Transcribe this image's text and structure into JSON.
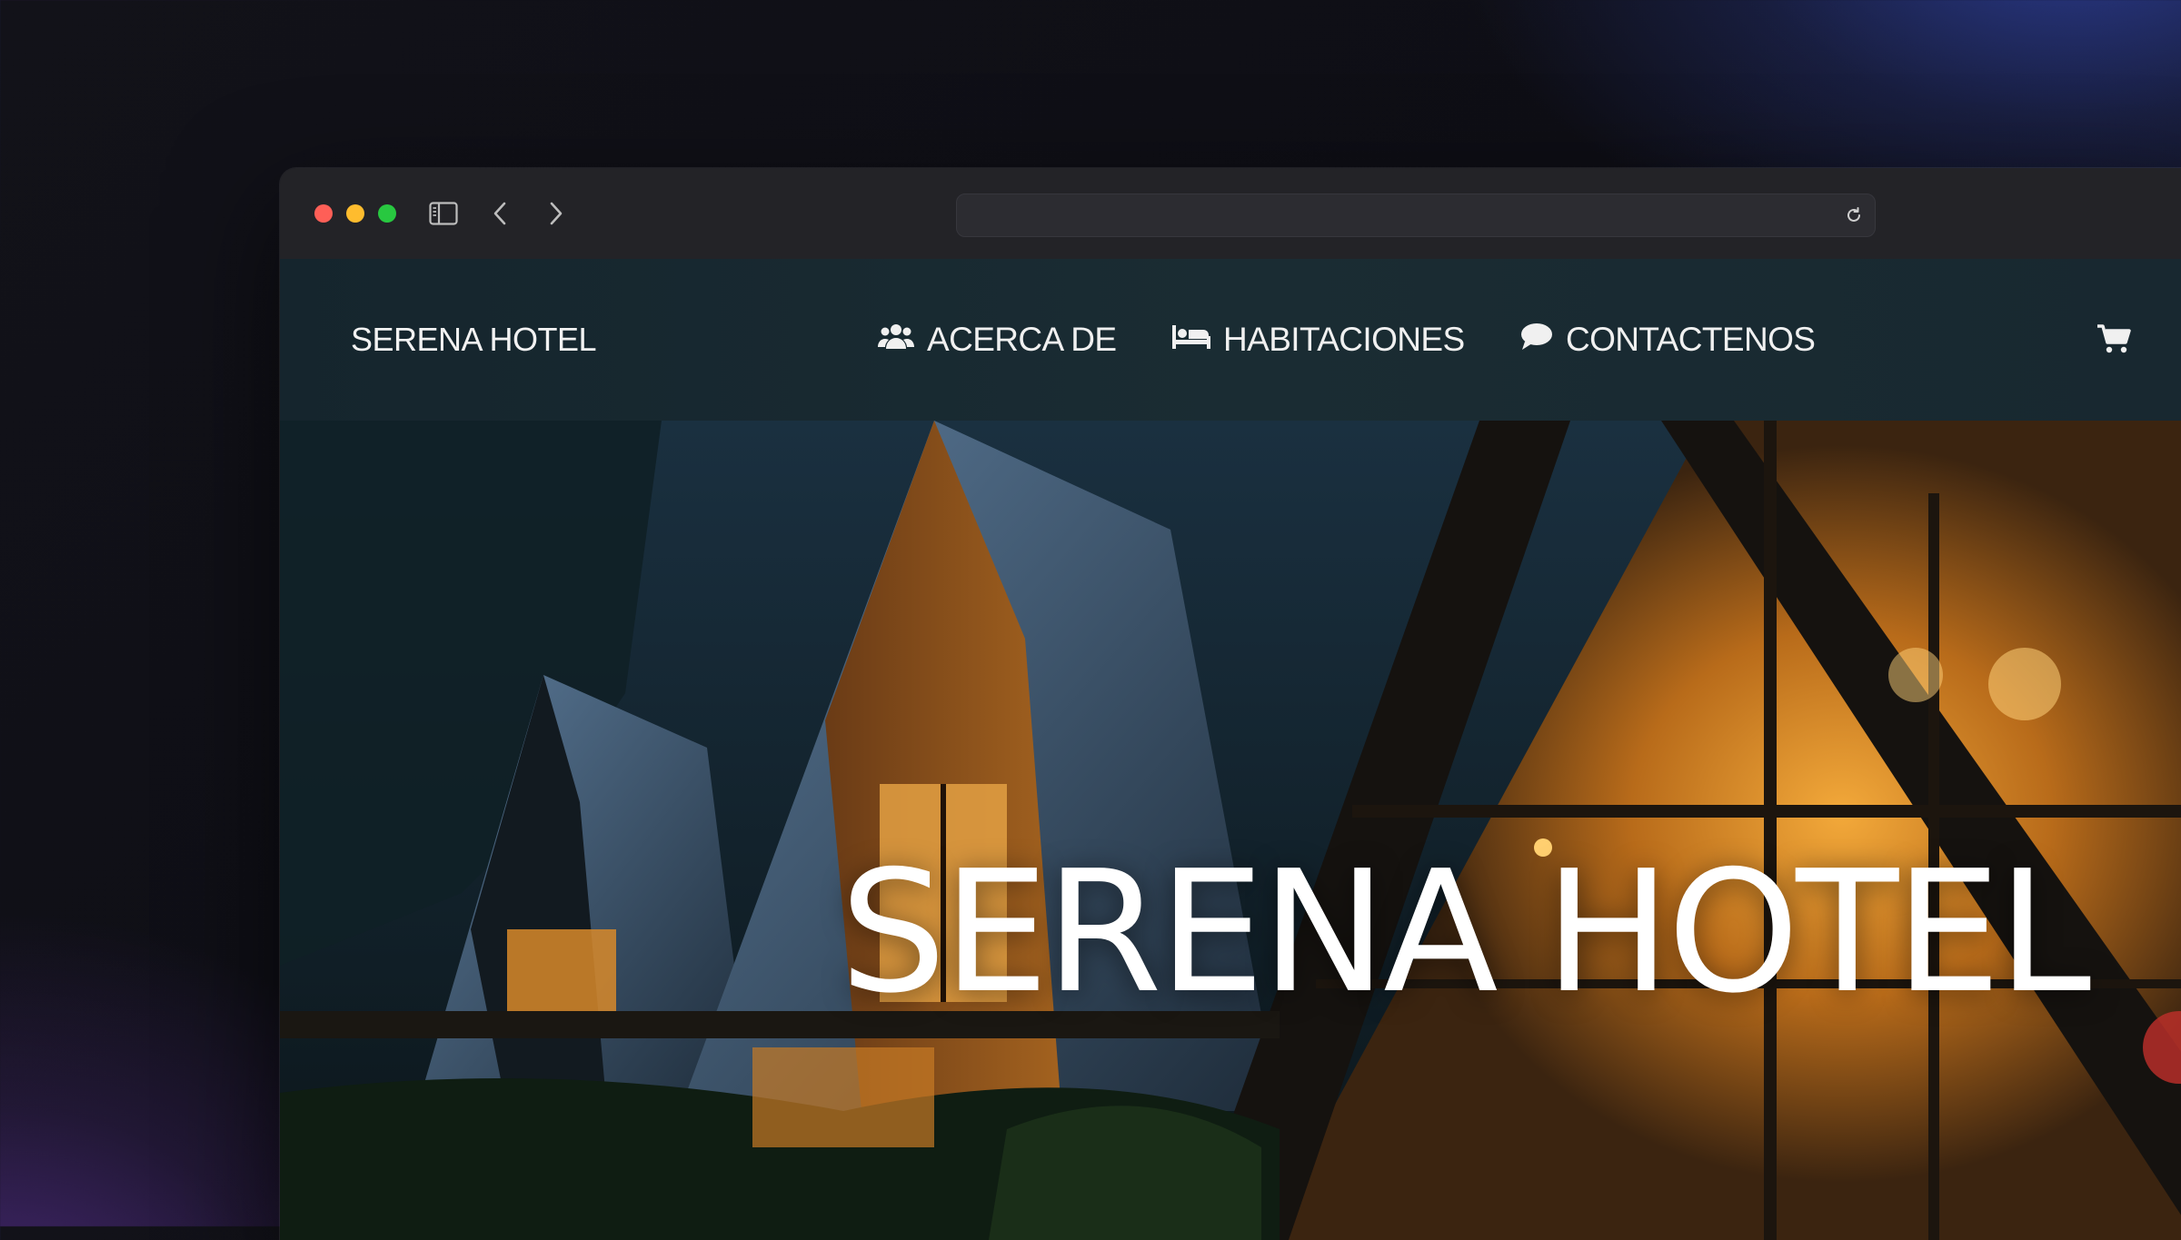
{
  "browser": {
    "url": "",
    "controls": {
      "close": "close-icon",
      "minimize": "minimize-icon",
      "zoom": "zoom-icon",
      "sidebar": "sidebar-icon",
      "back": "chevron-left-icon",
      "forward": "chevron-right-icon",
      "reload": "reload-icon"
    }
  },
  "navbar": {
    "brand": "SERENA HOTEL",
    "items": [
      {
        "label": "ACERCA DE",
        "icon": "users-icon"
      },
      {
        "label": "HABITACIONES",
        "icon": "bed-icon"
      },
      {
        "label": "CONTACTENOS",
        "icon": "chat-icon"
      }
    ],
    "cart_icon": "cart-icon"
  },
  "hero": {
    "title": "SERENA HOTEL"
  },
  "colors": {
    "navbar_bg": "#182a31",
    "text": "#f0f0f0",
    "window_chrome": "#232327"
  }
}
